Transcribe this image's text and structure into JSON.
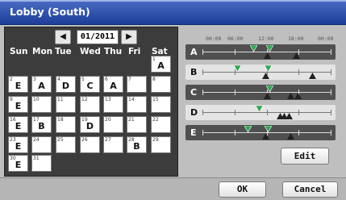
{
  "window": {
    "title": "Lobby (South)"
  },
  "calendar": {
    "month": "01/2011",
    "prev_icon": "left-arrow-icon",
    "next_icon": "right-arrow-icon",
    "weekdays": [
      "Sun",
      "Mon",
      "Tue",
      "Wed",
      "Thu",
      "Fri",
      "Sat"
    ],
    "days": [
      {
        "num": "1",
        "pattern": "A"
      },
      {
        "num": "2",
        "pattern": "E"
      },
      {
        "num": "3",
        "pattern": "A"
      },
      {
        "num": "4",
        "pattern": "D"
      },
      {
        "num": "5",
        "pattern": "C"
      },
      {
        "num": "6",
        "pattern": "A"
      },
      {
        "num": "7",
        "pattern": ""
      },
      {
        "num": "8",
        "pattern": ""
      },
      {
        "num": "9",
        "pattern": "E"
      },
      {
        "num": "10",
        "pattern": ""
      },
      {
        "num": "11",
        "pattern": ""
      },
      {
        "num": "12",
        "pattern": ""
      },
      {
        "num": "13",
        "pattern": ""
      },
      {
        "num": "14",
        "pattern": ""
      },
      {
        "num": "15",
        "pattern": ""
      },
      {
        "num": "16",
        "pattern": "E"
      },
      {
        "num": "17",
        "pattern": "B"
      },
      {
        "num": "18",
        "pattern": ""
      },
      {
        "num": "19",
        "pattern": "D"
      },
      {
        "num": "20",
        "pattern": ""
      },
      {
        "num": "21",
        "pattern": ""
      },
      {
        "num": "22",
        "pattern": ""
      },
      {
        "num": "23",
        "pattern": "E"
      },
      {
        "num": "24",
        "pattern": ""
      },
      {
        "num": "25",
        "pattern": ""
      },
      {
        "num": "26",
        "pattern": ""
      },
      {
        "num": "27",
        "pattern": ""
      },
      {
        "num": "28",
        "pattern": "B"
      },
      {
        "num": "29",
        "pattern": ""
      },
      {
        "num": "30",
        "pattern": "E"
      },
      {
        "num": "31",
        "pattern": ""
      }
    ],
    "first_weekday_index": 6
  },
  "timeline": {
    "hours": [
      "00:00",
      "06:00",
      "12:00",
      "18:00",
      "00:00"
    ],
    "patterns": [
      {
        "label": "A",
        "style": "dark",
        "markers": [
          {
            "time": 9.5,
            "kind": "on"
          },
          {
            "time": 12.0,
            "kind": "off"
          },
          {
            "time": 12.5,
            "kind": "on"
          },
          {
            "time": 17.5,
            "kind": "off"
          }
        ]
      },
      {
        "label": "B",
        "style": "light",
        "markers": [
          {
            "time": 6.5,
            "kind": "on"
          },
          {
            "time": 11.7,
            "kind": "off"
          },
          {
            "time": 12.2,
            "kind": "on"
          },
          {
            "time": 20.5,
            "kind": "off"
          }
        ]
      },
      {
        "label": "C",
        "style": "dark",
        "markers": [
          {
            "time": 12.0,
            "kind": "off"
          },
          {
            "time": 12.5,
            "kind": "on"
          },
          {
            "time": 16.5,
            "kind": "off"
          },
          {
            "time": 17.8,
            "kind": "off"
          }
        ]
      },
      {
        "label": "D",
        "style": "light",
        "markers": [
          {
            "time": 10.5,
            "kind": "on"
          },
          {
            "time": 14.5,
            "kind": "off"
          },
          {
            "time": 15.3,
            "kind": "off"
          },
          {
            "time": 16.1,
            "kind": "off"
          }
        ]
      },
      {
        "label": "E",
        "style": "dark",
        "markers": [
          {
            "time": 8.5,
            "kind": "on"
          },
          {
            "time": 11.8,
            "kind": "off"
          },
          {
            "time": 12.3,
            "kind": "on"
          },
          {
            "time": 16.5,
            "kind": "off"
          }
        ]
      }
    ],
    "edit_label": "Edit"
  },
  "footer": {
    "ok_label": "OK",
    "cancel_label": "Cancel"
  },
  "colors": {
    "on_marker": "#2fa84f",
    "off_marker": "#222222",
    "title_bar": "#2a4ca8"
  }
}
